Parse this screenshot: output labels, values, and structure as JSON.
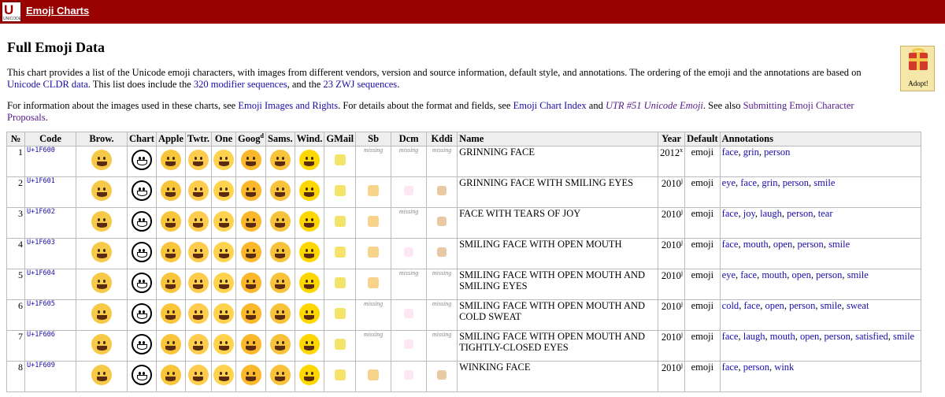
{
  "header": {
    "logo_text": "U",
    "logo_sub": "UNICODE",
    "title": "Emoji Charts"
  },
  "page_title": "Full Emoji Data",
  "intro": {
    "p1_a": "This chart provides a list of the Unicode emoji characters, with images from different vendors, version and source information, default style, and annotations. The ordering of the emoji and the annotations are based on ",
    "p1_link1": "Unicode CLDR data",
    "p1_b": ". This list does include the ",
    "p1_link2": "320 modifier sequences",
    "p1_c": ", and the ",
    "p1_link3": "23 ZWJ sequences",
    "p1_d": ".",
    "p2_a": "For information about the images used in these charts, see ",
    "p2_link1": "Emoji Images and Rights",
    "p2_b": ". For details about the format and fields, see ",
    "p2_link2": "Emoji Chart Index",
    "p2_c": " and ",
    "p2_link3": "UTR #51 Unicode Emoji",
    "p2_d": ". See also ",
    "p2_link4": "Submitting Emoji Character Proposals",
    "p2_e": "."
  },
  "adopt": {
    "label": "Adopt!"
  },
  "table": {
    "headers": {
      "num": "№",
      "code": "Code",
      "brow": "Brow.",
      "chart": "Chart",
      "apple": "Apple",
      "twtr": "Twtr.",
      "one": "One",
      "goog": "Goog",
      "goog_sup": "d",
      "sams": "Sams.",
      "wind": "Wind.",
      "gmail": "GMail",
      "sb": "Sb",
      "dcm": "Dcm",
      "kddi": "Kddi",
      "name": "Name",
      "year": "Year",
      "default": "Default",
      "annotations": "Annotations"
    },
    "missing_text": "missing",
    "rows": [
      {
        "num": "1",
        "code": "U+1F600",
        "name": "GRINNING FACE",
        "year": "2012",
        "year_sup": "x",
        "default": "emoji",
        "missing": {
          "sb": true,
          "dcm": true,
          "kddi": true
        },
        "annotations": [
          "face",
          "grin",
          "person"
        ]
      },
      {
        "num": "2",
        "code": "U+1F601",
        "name": "GRINNING FACE WITH SMILING EYES",
        "year": "2010",
        "year_sup": "j",
        "default": "emoji",
        "missing": {},
        "annotations": [
          "eye",
          "face",
          "grin",
          "person",
          "smile"
        ]
      },
      {
        "num": "3",
        "code": "U+1F602",
        "name": "FACE WITH TEARS OF JOY",
        "year": "2010",
        "year_sup": "j",
        "default": "emoji",
        "missing": {
          "dcm": true
        },
        "annotations": [
          "face",
          "joy",
          "laugh",
          "person",
          "tear"
        ]
      },
      {
        "num": "4",
        "code": "U+1F603",
        "name": "SMILING FACE WITH OPEN MOUTH",
        "year": "2010",
        "year_sup": "j",
        "default": "emoji",
        "missing": {},
        "annotations": [
          "face",
          "mouth",
          "open",
          "person",
          "smile"
        ]
      },
      {
        "num": "5",
        "code": "U+1F604",
        "name": "SMILING FACE WITH OPEN MOUTH AND SMILING EYES",
        "year": "2010",
        "year_sup": "j",
        "default": "emoji",
        "missing": {
          "dcm": true,
          "kddi": true
        },
        "annotations": [
          "eye",
          "face",
          "mouth",
          "open",
          "person",
          "smile"
        ]
      },
      {
        "num": "6",
        "code": "U+1F605",
        "name": "SMILING FACE WITH OPEN MOUTH AND COLD SWEAT",
        "year": "2010",
        "year_sup": "j",
        "default": "emoji",
        "missing": {
          "sb": true,
          "kddi": true
        },
        "annotations": [
          "cold",
          "face",
          "open",
          "person",
          "smile",
          "sweat"
        ]
      },
      {
        "num": "7",
        "code": "U+1F606",
        "name": "SMILING FACE WITH OPEN MOUTH AND TIGHTLY-CLOSED EYES",
        "year": "2010",
        "year_sup": "j",
        "default": "emoji",
        "missing": {
          "sb": true,
          "kddi": true
        },
        "annotations": [
          "face",
          "laugh",
          "mouth",
          "open",
          "person",
          "satisfied",
          "smile"
        ]
      },
      {
        "num": "8",
        "code": "U+1F609",
        "name": "WINKING FACE",
        "year": "2010",
        "year_sup": "j",
        "default": "emoji",
        "missing": {},
        "annotations": [
          "face",
          "person",
          "wink"
        ]
      }
    ]
  },
  "colors": {
    "header_bg": "#990000",
    "emoji_yellow": "#f7c948",
    "emoji_yellow_dark": "#f4b400",
    "google_yellow": "#fbc02d",
    "gmail_bg": "#fff3a0",
    "link": "#1a0dab"
  }
}
